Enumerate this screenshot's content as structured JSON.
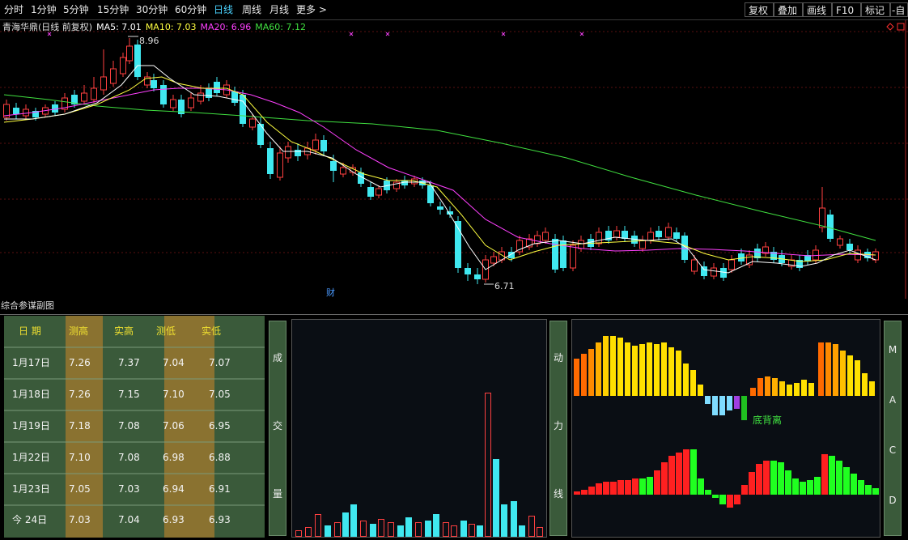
{
  "toolbar": {
    "periods": [
      "分时",
      "1分钟",
      "5分钟",
      "15分钟",
      "30分钟",
      "60分钟",
      "日线",
      "周线",
      "月线",
      "更多 >"
    ],
    "active": "日线",
    "right_buttons": [
      "复权",
      "叠加",
      "画线",
      "F10",
      "标记",
      "-自"
    ]
  },
  "chart": {
    "title": "青海华鼎(日线 前复权)",
    "ma": [
      {
        "label": "MA5: 7.01",
        "color": "#ffffff"
      },
      {
        "label": "MA10: 7.03",
        "color": "#ffff40"
      },
      {
        "label": "MA20: 6.96",
        "color": "#ff40ff"
      },
      {
        "label": "MA60: 7.12",
        "color": "#40e040"
      }
    ],
    "high_label": "8.96",
    "low_label": "6.71",
    "marker_label": "财",
    "colors": {
      "up": "#ff4040",
      "down": "#40e8f0"
    }
  },
  "subchart": {
    "title": "综合参谋副图"
  },
  "table": {
    "headers": [
      "日 期",
      "测高",
      "实高",
      "测低",
      "实低"
    ],
    "rows": [
      [
        "1月17日",
        "7.26",
        "7.37",
        "7.04",
        "7.07"
      ],
      [
        "1月18日",
        "7.26",
        "7.15",
        "7.10",
        "7.05"
      ],
      [
        "1月19日",
        "7.18",
        "7.08",
        "7.06",
        "6.95"
      ],
      [
        "1月22日",
        "7.10",
        "7.08",
        "6.98",
        "6.88"
      ],
      [
        "1月23日",
        "7.05",
        "7.03",
        "6.94",
        "6.91"
      ],
      [
        "今  24日",
        "7.03",
        "7.04",
        "6.93",
        "6.93"
      ]
    ]
  },
  "volume_button": {
    "label": [
      "成",
      "交",
      "量"
    ]
  },
  "momentum_button": {
    "label": [
      "动",
      "力",
      "线"
    ]
  },
  "macd_button": {
    "label": [
      "M",
      "A",
      "C",
      "D"
    ]
  },
  "indicator": {
    "divergence_label": "底背离"
  }
}
